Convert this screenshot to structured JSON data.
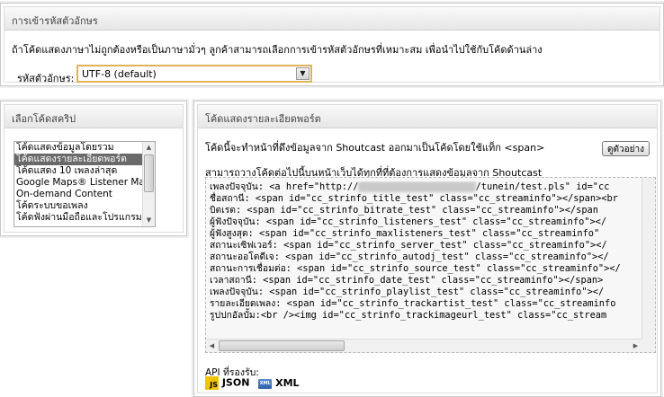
{
  "encoding": {
    "title": "การเข้ารหัสตัวอักษร",
    "description": "ถ้าโค้ดแสดงภาษาไม่ถูกต้องหรือเป็นภาษามั่วๆ ลูกค้าสามารถเลือกการเข้ารหัสตัวอักษรที่เหมาะสม เพื่อนำไปใช้กับโค้ดด้านล่าง",
    "label": "รหัสตัวอักษร:",
    "selected": "UTF-8 (default)"
  },
  "script": {
    "title": "เลือกโค้ดสคริป",
    "items": [
      "โค้ดแสดงข้อมูลโดยรวม",
      "โค้ดแสดงรายละเอียดพอร์ต",
      "โค้ดแสดง 10 เพลงล่าสุด",
      "Google Maps® Listener Map",
      "On-demand Content",
      "โค้ดระบบขอเพลง",
      "โค้ดฟังผ่านมือถือและโปรแกรม"
    ],
    "selected_index": 1
  },
  "code": {
    "title": "โค้ดแสดงรายละเอียดพอร์ต",
    "desc1": "โค้ดนี้จะทำหน้าที่ดึงข้อมูลจาก Shoutcast ออกมาเป็นโค้ดโดยใช้แท็ก <span>",
    "desc2": "สามารถวางโค้ดต่อไปนี้บนหน้าเว็บได้ทุกที่ที่ต้องการแสดงข้อมูลจาก Shoutcast",
    "example_button": "ดูตัวอย่าง",
    "lines": [
      {
        "pre": "เพลงปัจจุบัน: <a href=\"http://",
        "blur": "xx.xxxxxxxxx.xxx:xxxx",
        "post": "/tunein/test.pls\" id=\"cc"
      },
      {
        "pre": "ชื่อสถานี: <span id=\"cc_strinfo_title_test\" class=\"cc_streaminfo\"></span><br",
        "blur": "",
        "post": ""
      },
      {
        "pre": "บิตเรต: <span id=\"cc_strinfo_bitrate_test\" class=\"cc_streaminfo\"></span",
        "blur": "",
        "post": ""
      },
      {
        "pre": "ผู้ฟังปัจจุบัน: <span id=\"cc_strinfo_listeners_test\" class=\"cc_streaminfo\"></",
        "blur": "",
        "post": ""
      },
      {
        "pre": "ผู้ฟังสูงสุด: <span id=\"cc_strinfo_maxlisteners_test\" class=\"cc_streaminfo\"",
        "blur": "",
        "post": ""
      },
      {
        "pre": "สถานะเซิฟเวอร์: <span id=\"cc_strinfo_server_test\" class=\"cc_streaminfo\"></",
        "blur": "",
        "post": ""
      },
      {
        "pre": "สถานะออโตดีเจ: <span id=\"cc_strinfo_autodj_test\" class=\"cc_streaminfo\"></",
        "blur": "",
        "post": ""
      },
      {
        "pre": "สถานะการเชื่อมต่อ: <span id=\"cc_strinfo_source_test\" class=\"cc_streaminfo\"></",
        "blur": "",
        "post": ""
      },
      {
        "pre": "เวลาสถานี: <span id=\"cc_strinfo_date_test\" class=\"cc_streaminfo\"></span>",
        "blur": "",
        "post": ""
      },
      {
        "pre": "เพลงปัจจุบัน: <span id=\"cc_strinfo_playlist_test\" class=\"cc_streaminfo\"></",
        "blur": "",
        "post": ""
      },
      {
        "pre": "รายละเอียดเพลง: <span id=\"cc_strinfo_trackartist_test\" class=\"cc_streaminfo",
        "blur": "",
        "post": ""
      },
      {
        "pre": "รูปปกอัลบั้ม:<br /><img id=\"cc_strinfo_trackimageurl_test\" class=\"cc_stream",
        "blur": "",
        "post": ""
      }
    ],
    "api_label": "API ที่รองรับ:",
    "api": [
      {
        "icon": "json-icon",
        "label": "JSON"
      },
      {
        "icon": "xml-icon",
        "label": "XML"
      }
    ]
  }
}
